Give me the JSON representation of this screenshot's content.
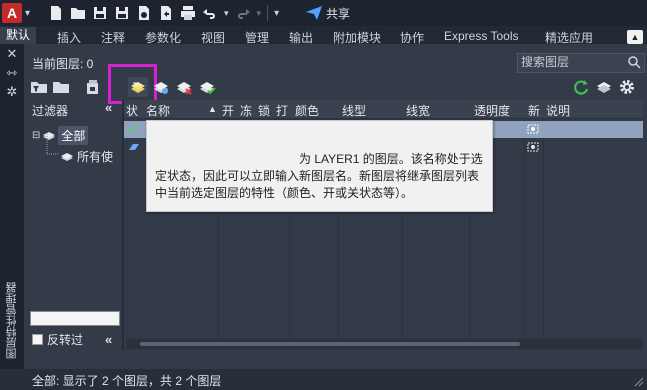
{
  "app": {
    "logo": "A",
    "share_label": "共享"
  },
  "ribbon": {
    "tabs": [
      {
        "label": "默认"
      },
      {
        "label": "插入"
      },
      {
        "label": "注释"
      },
      {
        "label": "参数化"
      },
      {
        "label": "视图"
      },
      {
        "label": "管理"
      },
      {
        "label": "输出"
      },
      {
        "label": "附加模块"
      },
      {
        "label": "协作"
      },
      {
        "label": "Express Tools"
      },
      {
        "label": "精选应用"
      }
    ]
  },
  "strip": {
    "title": "图层特性管理器"
  },
  "panel": {
    "current_layer": "当前图层: 0",
    "search_placeholder": "搜索图层"
  },
  "filters": {
    "header": "过滤器",
    "collapse_glyph": "«",
    "tree_all": "全部",
    "tree_used": "所有使",
    "invert_label": "反转过"
  },
  "columns": {
    "status": "状",
    "name": "名称",
    "on": "开",
    "freeze": "冻",
    "lock": "锁",
    "plot": "打",
    "color": "颜色",
    "linetype": "线型",
    "lineweight": "线宽",
    "transparency": "透明度",
    "new_vp": "新",
    "description": "说明"
  },
  "tooltip": {
    "line1": "为 LAYER1 的图层。该名称处于选",
    "line2": "定状态，因此可以立即输入新图层名。新图层将继承图层列表",
    "line3": "中当前选定图层的特性（颜色、开或关状态等）。"
  },
  "status": {
    "text": "全部: 显示了 2 个图层，共 2 个图层"
  },
  "colors": {
    "highlight": "#d321d3",
    "selected_row": "#8fa3bf",
    "panel_bg": "#343b48"
  }
}
